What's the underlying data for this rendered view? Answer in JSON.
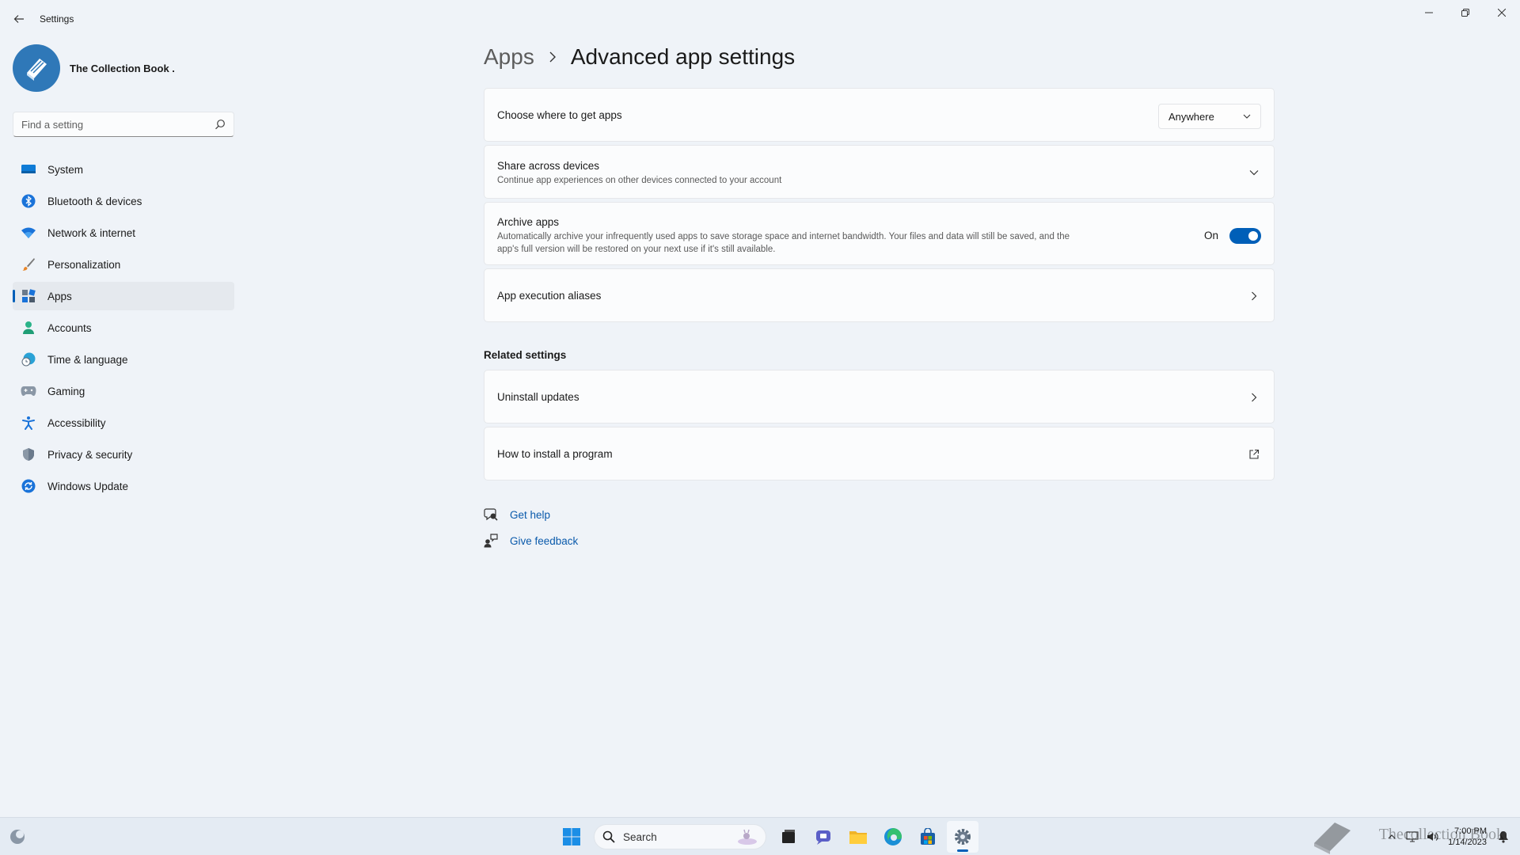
{
  "window": {
    "app_title": "Settings",
    "controls": {
      "minimize": "minimize",
      "restore": "restore",
      "close": "close"
    }
  },
  "profile": {
    "name": "The Collection Book ."
  },
  "search": {
    "placeholder": "Find a setting"
  },
  "sidebar": {
    "items": [
      {
        "label": "System",
        "icon": "monitor-icon"
      },
      {
        "label": "Bluetooth & devices",
        "icon": "bluetooth-icon"
      },
      {
        "label": "Network & internet",
        "icon": "wifi-icon"
      },
      {
        "label": "Personalization",
        "icon": "brush-icon"
      },
      {
        "label": "Apps",
        "icon": "apps-icon",
        "active": true
      },
      {
        "label": "Accounts",
        "icon": "person-icon"
      },
      {
        "label": "Time & language",
        "icon": "globe-clock-icon"
      },
      {
        "label": "Gaming",
        "icon": "gamepad-icon"
      },
      {
        "label": "Accessibility",
        "icon": "accessibility-icon"
      },
      {
        "label": "Privacy & security",
        "icon": "shield-icon"
      },
      {
        "label": "Windows Update",
        "icon": "update-icon"
      }
    ]
  },
  "breadcrumb": {
    "parent": "Apps",
    "current": "Advanced app settings"
  },
  "settings": {
    "get_apps": {
      "title": "Choose where to get apps",
      "value": "Anywhere"
    },
    "share": {
      "title": "Share across devices",
      "description": "Continue app experiences on other devices connected to your account"
    },
    "archive": {
      "title": "Archive apps",
      "description_line1": "Automatically archive your infrequently used apps to save storage space and internet bandwidth. Your files and data will still be saved, and the",
      "description_line2": "app's full version will be restored on your next use if it's still available.",
      "state_label": "On",
      "enabled": true
    },
    "aliases": {
      "title": "App execution aliases"
    }
  },
  "related": {
    "heading": "Related settings",
    "uninstall": {
      "title": "Uninstall updates"
    },
    "install": {
      "title": "How to install a program"
    }
  },
  "help": {
    "get_help": "Get help",
    "feedback": "Give feedback"
  },
  "taskbar": {
    "search_label": "Search",
    "clock_time": "7:00 PM",
    "clock_date": "1/14/2023",
    "watermark": "Thecollection Book"
  },
  "colors": {
    "accent": "#005fb8",
    "link": "#0a5aab",
    "background": "#eff3f8"
  }
}
